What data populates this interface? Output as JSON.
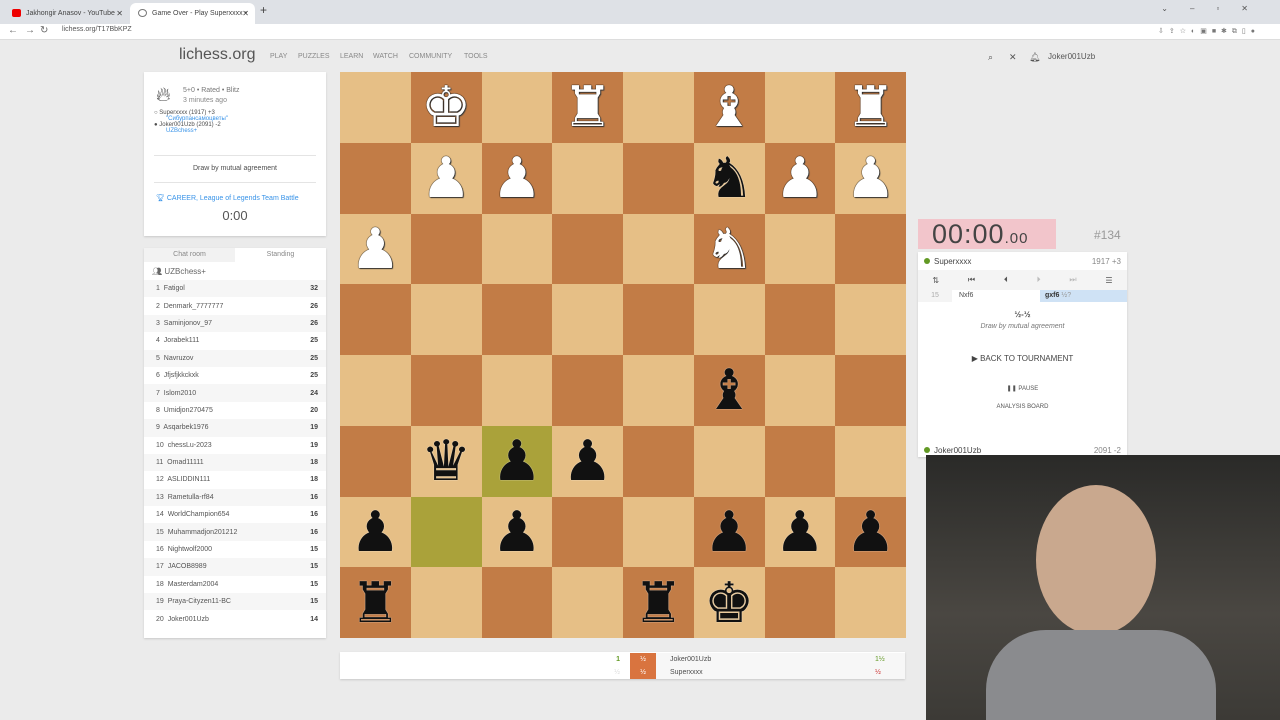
{
  "browser": {
    "tabs": [
      {
        "title": "Jakhongir Anasov - YouTube"
      },
      {
        "title": "Game Over - Play Superxxxx • lic"
      }
    ],
    "url": "lichess.org/T17BbKPZ"
  },
  "header": {
    "logo": "lichess.org",
    "nav": [
      "PLAY",
      "PUZZLES",
      "LEARN",
      "WATCH",
      "COMMUNITY",
      "TOOLS"
    ],
    "user": "Joker001Uzb"
  },
  "game_info": {
    "mode": "5+0 • Rated • Blitz",
    "time_ago": "3 minutes ago",
    "white": {
      "name": "Superxxxx (1917) +3",
      "team": "\"Сибурпансамоцветы\""
    },
    "black": {
      "name": "Joker001Uzb (2091) -2",
      "team": "UZBchess+"
    },
    "result": "Draw by mutual agreement",
    "tournament": "CAREER, League of Legends Team Battle",
    "tournament_clock": "0:00"
  },
  "standing": {
    "tabs": [
      "Chat room",
      "Standing"
    ],
    "team": "UZBchess+",
    "rows": [
      {
        "rank": "1",
        "name": "Fatigol",
        "score": "32"
      },
      {
        "rank": "2",
        "name": "Denmark_7777777",
        "score": "26"
      },
      {
        "rank": "3",
        "name": "Saminjonov_97",
        "score": "26"
      },
      {
        "rank": "4",
        "name": "Jorabek111",
        "score": "25"
      },
      {
        "rank": "5",
        "name": "Navruzov",
        "score": "25"
      },
      {
        "rank": "6",
        "name": "Jfjsfjkkckxk",
        "score": "25"
      },
      {
        "rank": "7",
        "name": "Islom2010",
        "score": "24"
      },
      {
        "rank": "8",
        "name": "Umidjon270475",
        "score": "20"
      },
      {
        "rank": "9",
        "name": "Asqarbek1976",
        "score": "19"
      },
      {
        "rank": "10",
        "name": "chessLu-2023",
        "score": "19"
      },
      {
        "rank": "11",
        "name": "Omad11111",
        "score": "18"
      },
      {
        "rank": "12",
        "name": "ASLIDDIN111",
        "score": "18"
      },
      {
        "rank": "13",
        "name": "Rametulla-rf84",
        "score": "16"
      },
      {
        "rank": "14",
        "name": "WorldChampion654",
        "score": "16"
      },
      {
        "rank": "15",
        "name": "Muhammadjon201212",
        "score": "16"
      },
      {
        "rank": "16",
        "name": "Nightwolf2000",
        "score": "15"
      },
      {
        "rank": "17",
        "name": "JACOB8989",
        "score": "15"
      },
      {
        "rank": "18",
        "name": "Masterdam2004",
        "score": "15"
      },
      {
        "rank": "19",
        "name": "Praya-Cityzen11-BC",
        "score": "15"
      },
      {
        "rank": "20",
        "name": "Joker001Uzb",
        "score": "14"
      }
    ]
  },
  "board": {
    "rows": [
      [
        "",
        "wK",
        "",
        "wR",
        "",
        "wB",
        "",
        "wR"
      ],
      [
        "",
        "wP",
        "wP",
        "",
        "",
        "bN",
        "wP",
        "wP"
      ],
      [
        "wP",
        "",
        "",
        "",
        "",
        "wN",
        "",
        ""
      ],
      [
        "",
        "",
        "",
        "",
        "",
        "",
        "",
        ""
      ],
      [
        "",
        "",
        "",
        "",
        "",
        "bB",
        "",
        ""
      ],
      [
        "",
        "bQ",
        "bP",
        "bP",
        "",
        "",
        "",
        ""
      ],
      [
        "bP",
        "",
        "bP",
        "",
        "",
        "bP",
        "bP",
        "bP"
      ],
      [
        "bR",
        "",
        "",
        "",
        "bR",
        "bK",
        "",
        ""
      ]
    ],
    "highlights": [
      [
        5,
        2
      ],
      [
        6,
        1
      ]
    ]
  },
  "clock": {
    "main": "00:00",
    "fraction": ".00",
    "game_number": "#134"
  },
  "top_player": {
    "name": "Superxxxx",
    "rating": "1917 +3"
  },
  "moves": {
    "number": "15",
    "white": "Nxf6",
    "black": "gxf6",
    "annotation": "½?"
  },
  "result": {
    "score": "½-½",
    "text": "Draw by mutual agreement",
    "back": "BACK TO TOURNAMENT",
    "pause": "PAUSE",
    "analysis": "ANALYSIS BOARD"
  },
  "bottom_player": {
    "name": "Joker001Uzb",
    "rating": "2091 -2"
  },
  "scoreboard": {
    "rows": [
      {
        "num": "1",
        "mid": "½",
        "name": "Joker001Uzb",
        "total": "1½"
      },
      {
        "num": "½",
        "mid": "½",
        "name": "Superxxxx",
        "total": "½"
      }
    ]
  },
  "colors": {
    "light": "#e6bf86",
    "dark": "#c27c46",
    "clock_bg": "#f2c5cb",
    "link": "#3893e8"
  }
}
